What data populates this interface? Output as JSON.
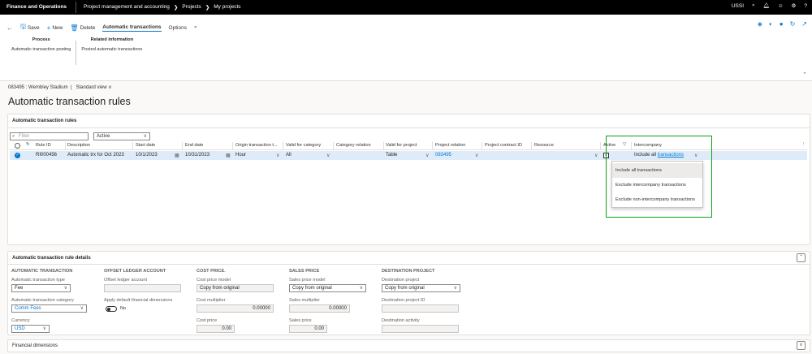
{
  "nav": {
    "app_title": "Finance and Operations",
    "breadcrumb": [
      "Project management and accounting",
      "Projects",
      "My projects"
    ],
    "company": "USSI"
  },
  "actions": {
    "save": "Save",
    "new": "New",
    "delete": "Delete",
    "automatic_transactions": "Automatic transactions",
    "options": "Options"
  },
  "ribbon": {
    "process_header": "Process",
    "process_item": "Automatic transaction posting",
    "related_header": "Related information",
    "related_item": "Posted automatic transactions"
  },
  "record": {
    "caption": "083495 : Wembley Stadium",
    "view": "Standard view"
  },
  "page_title": "Automatic transaction rules",
  "rules_panel": {
    "header": "Automatic transaction rules",
    "filter_placeholder": "Filter",
    "status_filter": "Active",
    "columns": {
      "rule_id": "Rule ID",
      "description": "Description",
      "start_date": "Start date",
      "end_date": "End date",
      "origin": "Origin transaction t...",
      "valid_category": "Valid for category",
      "category_relation": "Category relation",
      "valid_project": "Valid for project",
      "project_relation": "Project relation",
      "contract": "Project contract ID",
      "resource": "Resource",
      "active": "Active",
      "intercompany": "Intercompany"
    },
    "row": {
      "rule_id": "RI000456",
      "description": "Automatic trx for Oct 2023",
      "start_date": "10/1/2023",
      "end_date": "10/31/2023",
      "origin": "Hour",
      "valid_category": "All",
      "category_relation": "",
      "valid_project": "Table",
      "project_relation": "083495",
      "contract": "",
      "resource": "",
      "intercompany_prefix": "Include all ",
      "intercompany_link": "transactions"
    },
    "intercompany_options": [
      "Include all transactions",
      "Exclude intercompany transactions",
      "Exclude non-intercompany transactions"
    ]
  },
  "details": {
    "header": "Automatic transaction rule details",
    "automatic_transaction": {
      "title": "AUTOMATIC TRANSACTION",
      "type_label": "Automatic transaction type",
      "type_value": "Fee",
      "category_label": "Automatic transaction category",
      "category_value": "Comm Fees",
      "currency_label": "Currency",
      "currency_value": "USD"
    },
    "offset": {
      "title": "OFFSET LEDGER ACCOUNT",
      "account_label": "Offset ledger account",
      "account_value": "",
      "dims_label": "Apply default financial dimensions",
      "dims_value": "No"
    },
    "cost": {
      "title": "COST PRICE.",
      "model_label": "Cost price model",
      "model_value": "Copy from original",
      "multiplier_label": "Cost multiplier",
      "multiplier_value": "0.00000",
      "price_label": "Cost price",
      "price_value": "0.00"
    },
    "sales": {
      "title": "SALES PRICE",
      "model_label": "Sales price model",
      "model_value": "Copy from original",
      "multiplier_label": "Sales multiplier",
      "multiplier_value": "0.00000",
      "price_label": "Sales price",
      "price_value": "0.00"
    },
    "destination": {
      "title": "DESTINATION PROJECT",
      "project_label": "Destination project",
      "project_value": "Copy from original",
      "project_id_label": "Destination project ID",
      "project_id_value": "",
      "activity_label": "Destination activity",
      "activity_value": ""
    }
  },
  "financial_dimensions": "Financial dimensions",
  "colors": {
    "accent": "#0078d4",
    "selected_row": "#deecf9",
    "highlight_box": "#0fa30f"
  }
}
